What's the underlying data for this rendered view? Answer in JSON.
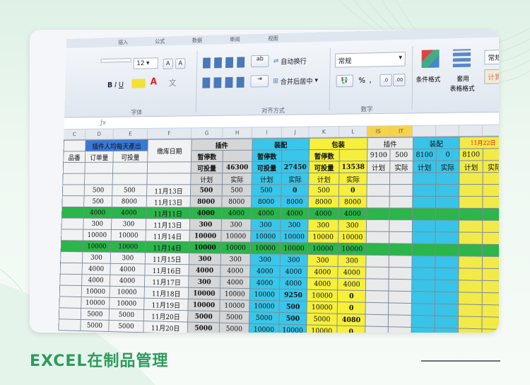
{
  "headline": "EXCEL在制品管理",
  "ribbon": {
    "menu_tabs": [
      "插入",
      "公式",
      "数据",
      "审阅",
      "视图"
    ],
    "font_size": "12",
    "wrap_text": "自动换行",
    "merge_center": "合并后居中",
    "number_format": "常规",
    "alignment_group": "对齐方式",
    "number_group": "数字",
    "font_group": "字体",
    "percent": "%",
    "conditional_format": "条件格式",
    "table_format_label": "套用",
    "table_format_label2": "表格格式",
    "style_normal": "常规 2",
    "style_calc": "计算",
    "colors": {
      "accent": "#2e9b5e",
      "cyan": "#38c6ea",
      "yellow": "#f6ef3c",
      "green": "#2bb54a",
      "red": "#e01010"
    }
  },
  "columns": [
    "C",
    "D",
    "E",
    "F",
    "G",
    "H",
    "I",
    "J",
    "K",
    "L",
    "IS",
    "IT",
    "",
    "",
    "",
    ""
  ],
  "left_header": {
    "banner": "插件人均每天產出",
    "labels": [
      "品番",
      "订单量",
      "可投量",
      "缴库日期"
    ]
  },
  "sections": {
    "plugin": {
      "title": "插件",
      "stop": "暂停数",
      "avail": "可投量",
      "avail_value": "46300",
      "plan": "计划",
      "actual": "实际"
    },
    "assembly": {
      "title": "装配",
      "stop": "暂停数",
      "avail": "可投量",
      "avail_value": "27450",
      "plan": "计划",
      "actual": "实际"
    },
    "packing": {
      "title": "包装",
      "stop": "暂停数",
      "avail": "可投量",
      "avail_value": "13538",
      "plan": "计划",
      "actual": "实际"
    }
  },
  "right_header": {
    "date": "11月22日",
    "plugin": "插件",
    "assembly": "装配",
    "values": [
      "9100",
      "500",
      "8100",
      "0",
      "8100"
    ],
    "plan": "计划",
    "actual": "实际"
  },
  "rows": [
    {
      "left": [
        "",
        "500",
        "500",
        "11月13日"
      ],
      "g": "500",
      "h": "500",
      "i": "500",
      "j": "0",
      "k": "500",
      "l": "0",
      "color": "normal",
      "j_red": true,
      "l_red": true
    },
    {
      "left": [
        "",
        "500",
        "8000",
        "11月13日"
      ],
      "g": "8000",
      "h": "8000",
      "i": "8000",
      "j": "8000",
      "k": "8000",
      "l": "8000",
      "color": "normal"
    },
    {
      "left": [
        "",
        "4000",
        "4000",
        "11月11日"
      ],
      "g": "4000",
      "h": "4000",
      "i": "4000",
      "j": "4000",
      "k": "4000",
      "l": "4000",
      "color": "green"
    },
    {
      "left": [
        "",
        "300",
        "300",
        "11月13日"
      ],
      "g": "300",
      "h": "300",
      "i": "300",
      "j": "300",
      "k": "300",
      "l": "300",
      "color": "normal"
    },
    {
      "left": [
        "",
        "10000",
        "10000",
        "11月14日"
      ],
      "g": "10000",
      "h": "10000",
      "i": "10000",
      "j": "10000",
      "k": "10000",
      "l": "10000",
      "color": "normal"
    },
    {
      "left": [
        "",
        "10000",
        "10000",
        "11月14日"
      ],
      "g": "10000",
      "h": "10000",
      "i": "10000",
      "j": "10000",
      "k": "10000",
      "l": "10000",
      "color": "green"
    },
    {
      "left": [
        "",
        "300",
        "300",
        "11月15日"
      ],
      "g": "300",
      "h": "300",
      "i": "300",
      "j": "300",
      "k": "300",
      "l": "300",
      "color": "normal"
    },
    {
      "left": [
        "",
        "4000",
        "4000",
        "11月16日"
      ],
      "g": "4000",
      "h": "4000",
      "i": "4000",
      "j": "4000",
      "k": "4000",
      "l": "4000",
      "color": "normal"
    },
    {
      "left": [
        "",
        "4000",
        "4000",
        "11月17日"
      ],
      "g": "300",
      "h": "4000",
      "i": "4000",
      "j": "4000",
      "k": "4000",
      "l": "4000",
      "color": "normal"
    },
    {
      "left": [
        "",
        "10000",
        "10000",
        "11月18日"
      ],
      "g": "10000",
      "h": "10000",
      "i": "10000",
      "j": "9250",
      "k": "10000",
      "l": "0",
      "color": "normal",
      "j_red": true,
      "l_red": true
    },
    {
      "left": [
        "",
        "10000",
        "10000",
        "11月19日"
      ],
      "g": "10000",
      "h": "10000",
      "i": "10000",
      "j": "500",
      "k": "10000",
      "l": "0",
      "color": "normal",
      "j_red": true,
      "l_red": true
    },
    {
      "left": [
        "",
        "5000",
        "5000",
        "11月20日"
      ],
      "g": "5000",
      "h": "5000",
      "i": "5000",
      "j": "500",
      "k": "5000",
      "l": "4080",
      "color": "normal",
      "j_red": true,
      "l_red": true
    },
    {
      "left": [
        "",
        "5000",
        "5000",
        "11月20日"
      ],
      "g": "5000",
      "h": "5000",
      "i": "10000",
      "j": "10000",
      "k": "10000",
      "l": "0",
      "color": "normal",
      "l_red": true
    }
  ]
}
